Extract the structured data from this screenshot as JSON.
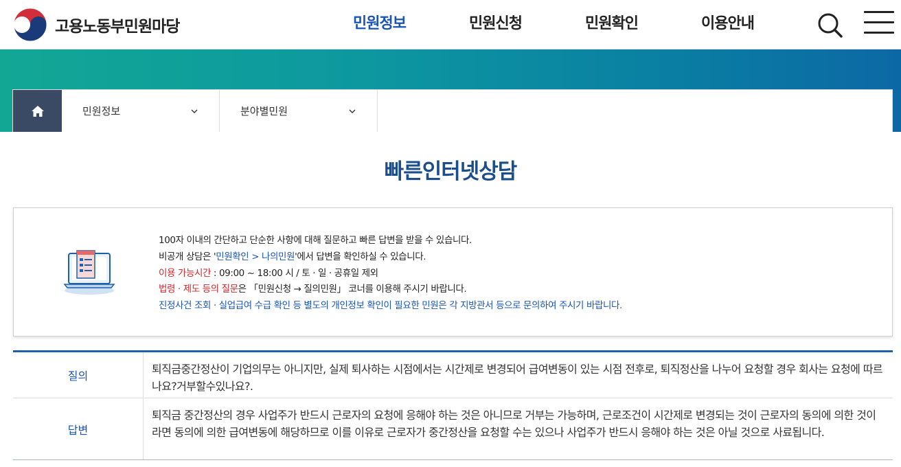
{
  "header": {
    "logo_text": "고용노동부민원마당",
    "nav": [
      {
        "label": "민원정보",
        "active": true
      },
      {
        "label": "민원신청",
        "active": false
      },
      {
        "label": "민원확인",
        "active": false
      },
      {
        "label": "이용안내",
        "active": false
      }
    ],
    "search_icon": "search-icon",
    "menu_icon": "hamburger-menu-icon"
  },
  "breadcrumb": {
    "home_icon": "home-icon",
    "level1": "민원정보",
    "level2": "분야별민원"
  },
  "page": {
    "title": "빠른인터넷상담"
  },
  "info": {
    "line1": "100자 이내의 간단하고 단순한 사항에 대해 질문하고 빠른 답변을 받을 수 있습니다.",
    "line2_pre": "비공개 상담은 '",
    "line2_link": "민원확인 > 나의민원",
    "line2_post": "'에서 답변을 확인하실 수 있습니다.",
    "line3_label": "이용 가능시간",
    "line3_text": " : 09:00 ~ 18:00 시 / 토 · 일 · 공휴일 제외",
    "line4_label": "법령 · 제도 등의 질문",
    "line4_text": "은 「민원신청 → 질의민원」 코너를 이용해 주시기 바랍니다.",
    "line5": "진정사건 조회 · 실업급여 수급 확인 등 별도의 개인정보 확인이 필요한 민원은 각 지방관서 등으로 문의하여 주시기 바랍니다."
  },
  "qa": {
    "question_label": "질의",
    "question_text": "퇴직금중간정산이 기업의무는 아니지만, 실제 퇴사하는 시점에서는 시간제로 변경되어 급여변동이 있는 시점 전후로, 퇴직정산을 나누어 요청할 경우 회사는 요청에 따르나요?거부할수있나요?.",
    "answer_label": "답변",
    "answer_text": "퇴직금 중간정산의 경우 사업주가 반드시 근로자의 요청에 응해야 하는 것은 아니므로 거부는 가능하며, 근로조건이 시간제로 변경되는 것이 근로자의 동의에 의한 것이라면 동의에 의한 급여변동에 해당하므로 이를 이유로 근로자가 중간정산을 요청할 수는 있으나 사업주가 반드시 응해야 하는 것은 아닐 것으로 사료됩니다."
  },
  "colors": {
    "accent_blue": "#1a55b5",
    "title_navy": "#1b4e8a",
    "warn_red": "#d0262a",
    "home_bg": "#3b4a64"
  }
}
